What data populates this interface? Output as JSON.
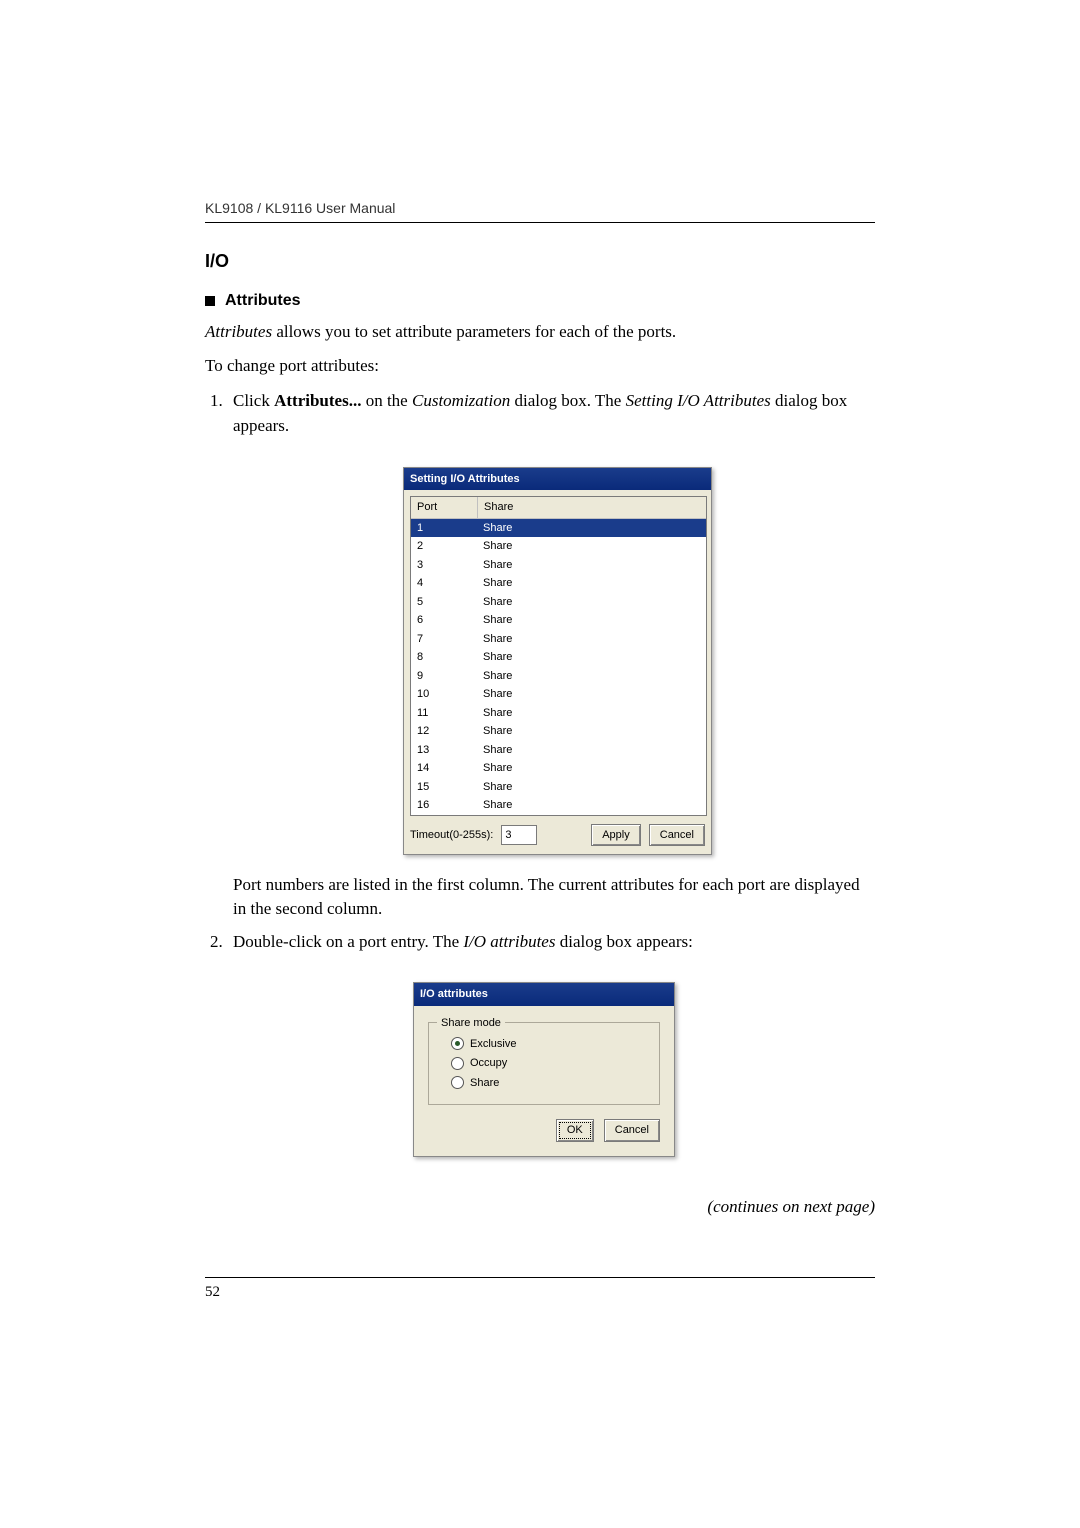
{
  "header": {
    "manual_title": "KL9108 / KL9116 User Manual"
  },
  "section": {
    "heading": "I/O"
  },
  "subsection": {
    "title": "Attributes"
  },
  "intro": {
    "word_attributes": "Attributes",
    "rest": " allows you to set attribute parameters for each of the ports.",
    "change_line": "To change port attributes:"
  },
  "steps": {
    "s1_pre": "Click ",
    "s1_bold": "Attributes...",
    "s1_mid": " on the ",
    "s1_italic1": "Customization",
    "s1_mid2": " dialog box. The ",
    "s1_italic2": "Setting I/O Attributes",
    "s1_post": " dialog box appears.",
    "s1_after": "Port numbers are listed in the first column. The current attributes for each port are displayed in the second column.",
    "s2_pre": "Double-click on a port entry. The ",
    "s2_italic": "I/O attributes",
    "s2_post": " dialog box appears:"
  },
  "dialog1": {
    "title": "Setting I/O Attributes",
    "col_port": "Port",
    "col_share": "Share",
    "rows": [
      {
        "port": "1",
        "share": "Share",
        "selected": true
      },
      {
        "port": "2",
        "share": "Share"
      },
      {
        "port": "3",
        "share": "Share"
      },
      {
        "port": "4",
        "share": "Share"
      },
      {
        "port": "5",
        "share": "Share"
      },
      {
        "port": "6",
        "share": "Share"
      },
      {
        "port": "7",
        "share": "Share"
      },
      {
        "port": "8",
        "share": "Share"
      },
      {
        "port": "9",
        "share": "Share"
      },
      {
        "port": "10",
        "share": "Share"
      },
      {
        "port": "11",
        "share": "Share"
      },
      {
        "port": "12",
        "share": "Share"
      },
      {
        "port": "13",
        "share": "Share"
      },
      {
        "port": "14",
        "share": "Share"
      },
      {
        "port": "15",
        "share": "Share"
      },
      {
        "port": "16",
        "share": "Share"
      }
    ],
    "timeout_label": "Timeout(0-255s):",
    "timeout_value": "3",
    "apply": "Apply",
    "cancel": "Cancel"
  },
  "dialog2": {
    "title": "I/O attributes",
    "group_legend": "Share mode",
    "opt_exclusive": "Exclusive",
    "opt_occupy": "Occupy",
    "opt_share": "Share",
    "selected": "Exclusive",
    "ok": "OK",
    "cancel": "Cancel"
  },
  "continues": "(continues on next page)",
  "page_number": "52"
}
